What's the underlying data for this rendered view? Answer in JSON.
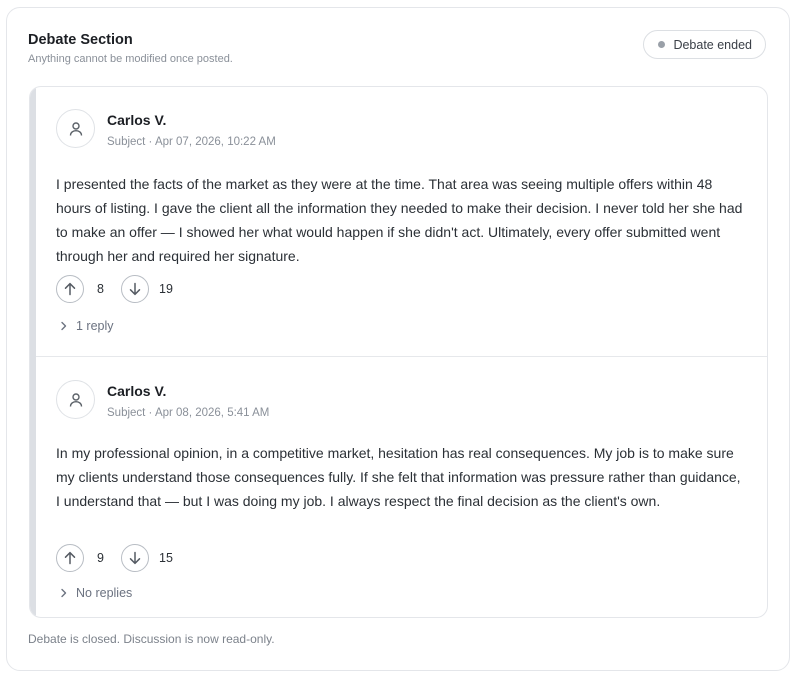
{
  "section": {
    "title": "Debate Section",
    "subtitle": "Anything cannot be modified once posted.",
    "status_label": "Debate ended"
  },
  "posts": [
    {
      "author": "Carlos V.",
      "meta": "Subject · Apr 07, 2026, 10:22 AM",
      "body": "I presented the facts of the market as they were at the time. That area was seeing multiple offers within 48 hours of listing. I gave the client all the information they needed to make their decision. I never told her she had to make an offer — I showed her what would happen if she didn't act. Ultimately, every offer submitted went through her and required her signature.",
      "upvotes": "8",
      "downvotes": "19",
      "replies_label": "1 reply",
      "icons": {
        "avatar": "user-icon",
        "upvote": "arrow-up-icon",
        "downvote": "arrow-down-icon",
        "replies": "chevron-right-icon"
      }
    },
    {
      "author": "Carlos V.",
      "meta": "Subject · Apr 08, 2026, 5:41 AM",
      "body": "In my professional opinion, in a competitive market, hesitation has real consequences. My job is to make sure my clients understand those consequences fully. If she felt that information was pressure rather than guidance, I understand that — but I was doing my job. I always respect the final decision as the client's own.",
      "upvotes": "9",
      "downvotes": "15",
      "replies_label": "No replies",
      "icons": {
        "avatar": "user-icon",
        "upvote": "arrow-up-icon",
        "downvote": "arrow-down-icon",
        "replies": "chevron-right-icon"
      }
    }
  ],
  "footer": {
    "note": "Debate is closed. Discussion is now read-only."
  },
  "colors": {
    "status_dot": "#9aa0a8",
    "rail": "#dcdfe4",
    "border": "#e4e6ea"
  }
}
